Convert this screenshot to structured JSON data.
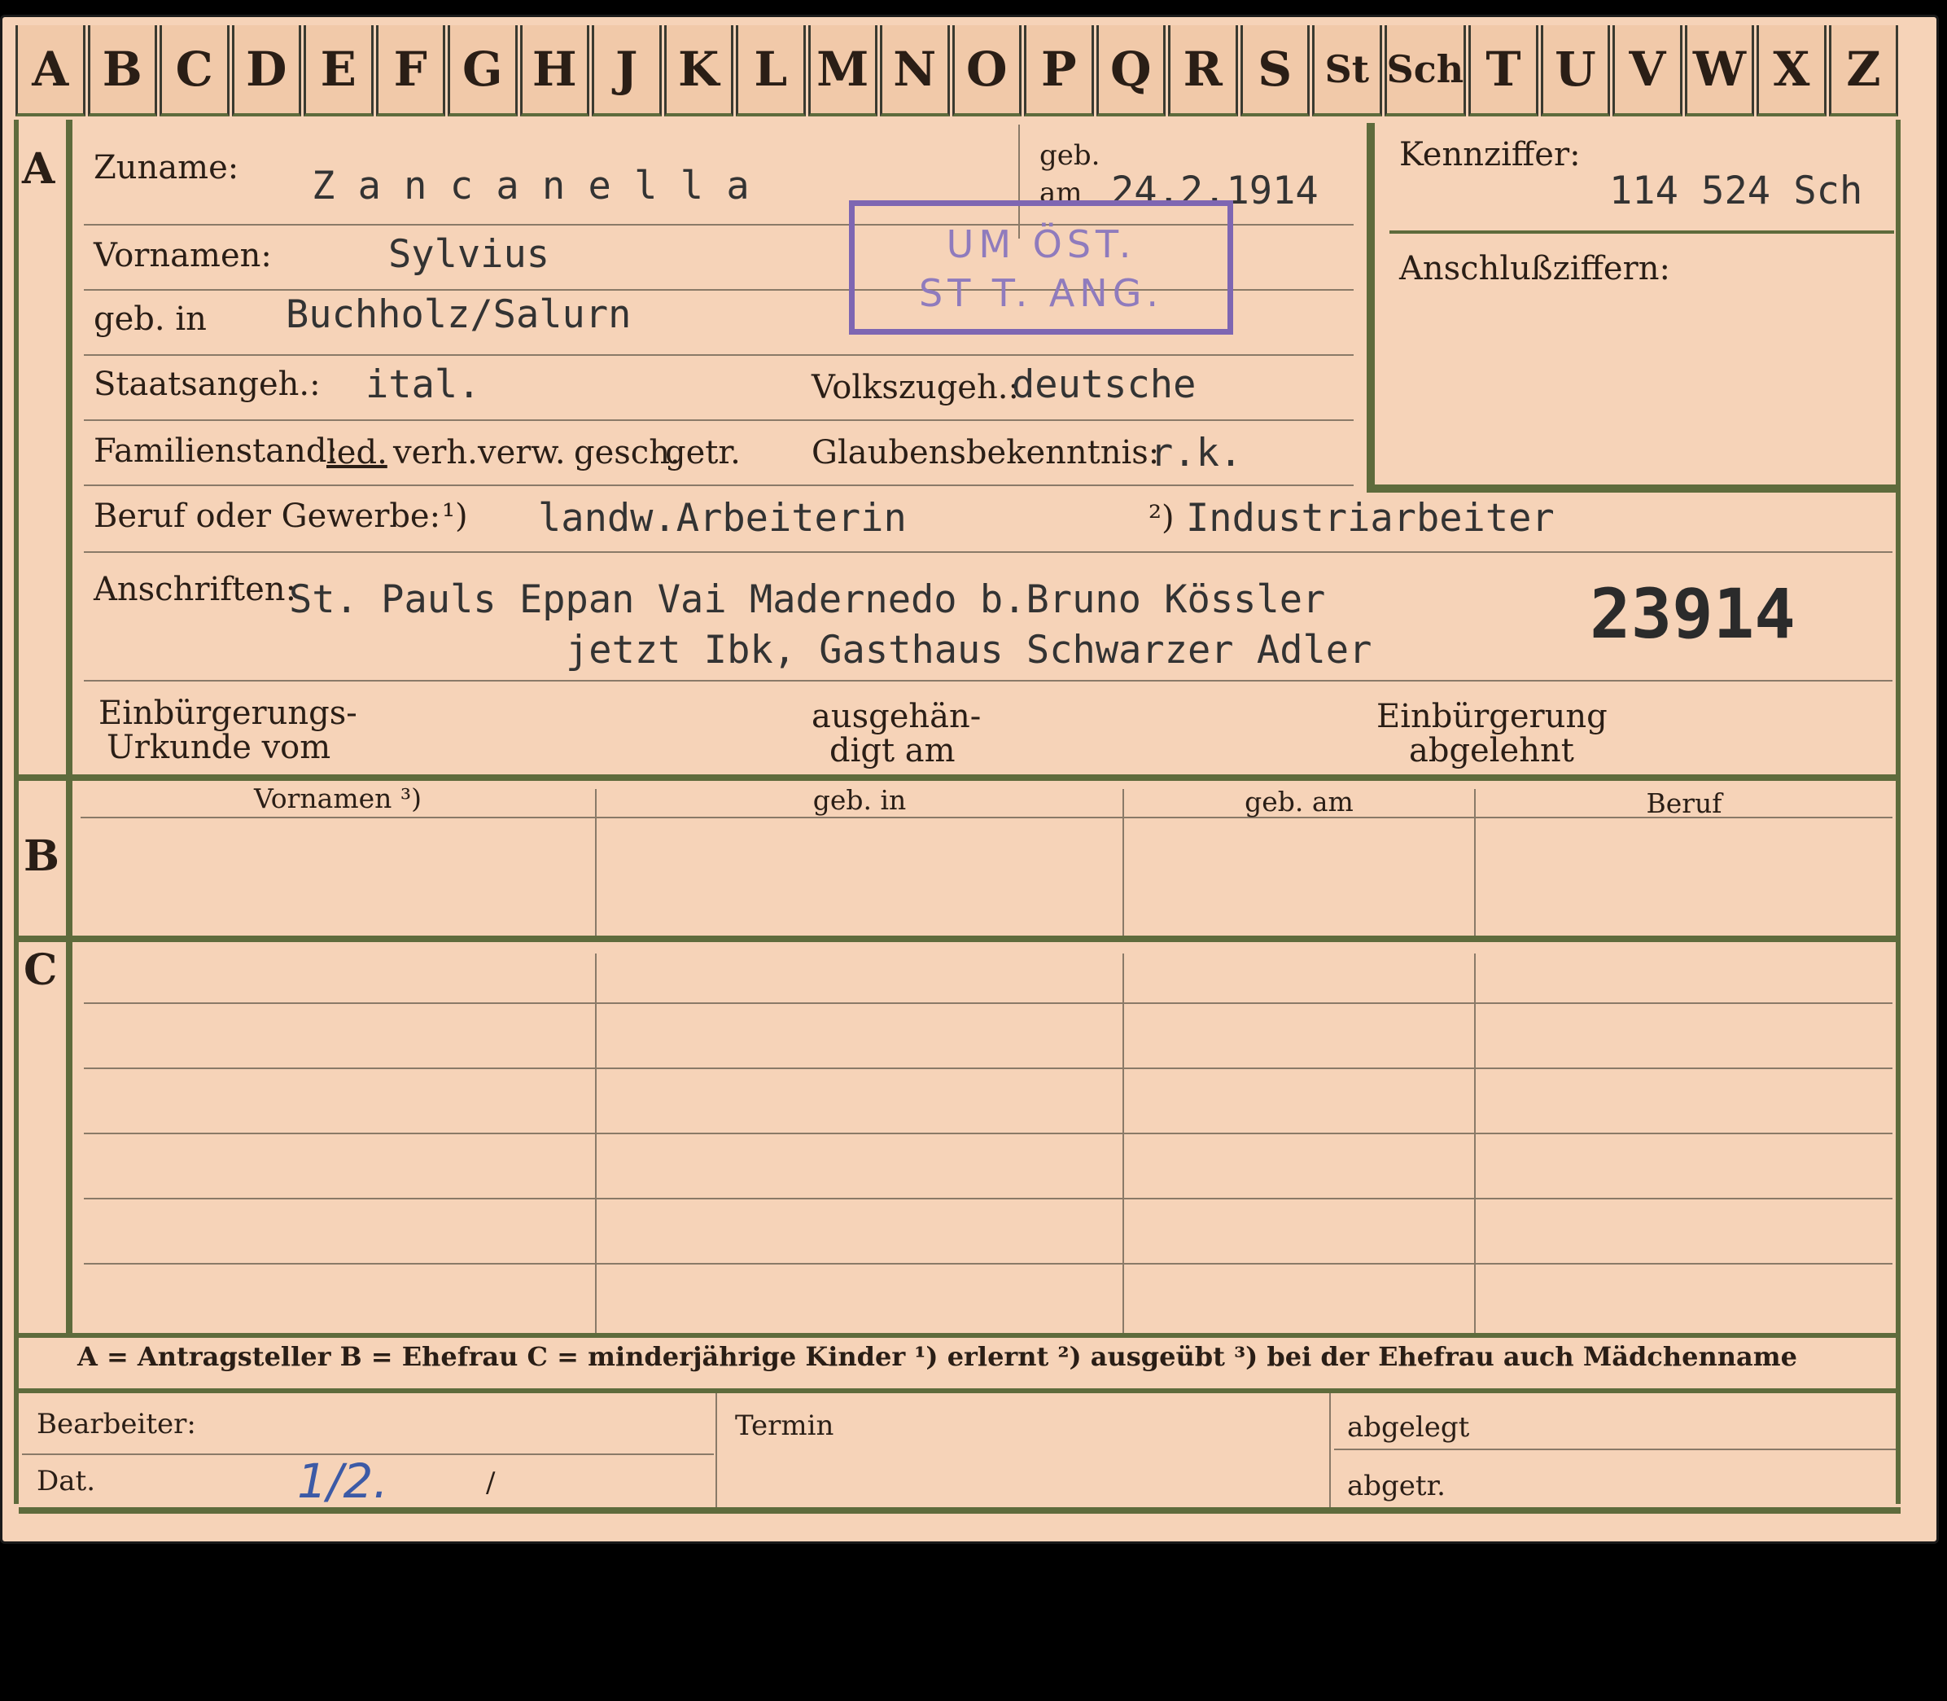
{
  "tabs": [
    "A",
    "B",
    "C",
    "D",
    "E",
    "F",
    "G",
    "H",
    "J",
    "K",
    "L",
    "M",
    "N",
    "O",
    "P",
    "Q",
    "R",
    "S",
    "St",
    "Sch",
    "T",
    "U",
    "V",
    "W",
    "X",
    "Z"
  ],
  "sections": {
    "a": "A",
    "b": "B",
    "c": "C"
  },
  "applicant": {
    "zuname_label": "Zuname:",
    "zuname": "Z a n c a n e l l a",
    "geb_label": "geb.",
    "am_label": "am",
    "birth_date": "24.2.1914",
    "vornamen_label": "Vornamen:",
    "vornamen": "Sylvius",
    "geb_in_label": "geb. in",
    "birthplace": "Buchholz/Salurn",
    "staatsangeh_label": "Staatsangeh.:",
    "staatsangeh": "ital.",
    "volkszugeh_label": "Volkszugeh.:",
    "volkszugeh": "deutsche",
    "familienstand_label": "Familienstand:",
    "familienstand_options": [
      "led.",
      "verh.",
      "verw.",
      "gesch.",
      "getr."
    ],
    "glauben_label": "Glaubensbekenntnis:",
    "glauben": "r.k.",
    "beruf_label": "Beruf oder Gewerbe:",
    "beruf_marker1": "¹)",
    "beruf_learned": "landw.Arbeiterin",
    "beruf_marker2": "²)",
    "beruf_practiced": "Industriarbeiter",
    "anschriften_label": "Anschriften:",
    "address_line1": "St. Pauls Eppan Vai Madernedo b.Bruno Kössler",
    "address_line2": "jetzt Ibk, Gasthaus Schwarzer Adler",
    "file_number": "23914",
    "einbuergerung_label1": "Einbürgerungs-",
    "einbuergerung_label2": "Urkunde vom",
    "ausgehaendigt_label1": "ausgehän-",
    "ausgehaendigt_label2": "digt am",
    "abgelehnt_label1": "Einbürgerung",
    "abgelehnt_label2": "abgelehnt"
  },
  "kennziffer": {
    "label": "Kennziffer:",
    "value": "114 524  Sch",
    "anschluss_label": "Anschlußziffern:"
  },
  "stamp": {
    "line1": "UM ÖST.",
    "line2": "ST    T. ANG."
  },
  "table_headers": [
    "Vornamen ³)",
    "geb. in",
    "geb. am",
    "Beruf"
  ],
  "legend": "A = Antragsteller   B = Ehefrau   C = minderjährige Kinder   ¹) erlernt   ²) ausgeübt   ³) bei der Ehefrau auch Mädchenname",
  "footer": {
    "bearbeiter_label": "Bearbeiter:",
    "dat_label": "Dat.",
    "dat_value": "1/2.",
    "dat_slash": "/",
    "termin_label": "Termin",
    "abgelegt_label": "abgelegt",
    "abgetr_label": "abgetr."
  }
}
